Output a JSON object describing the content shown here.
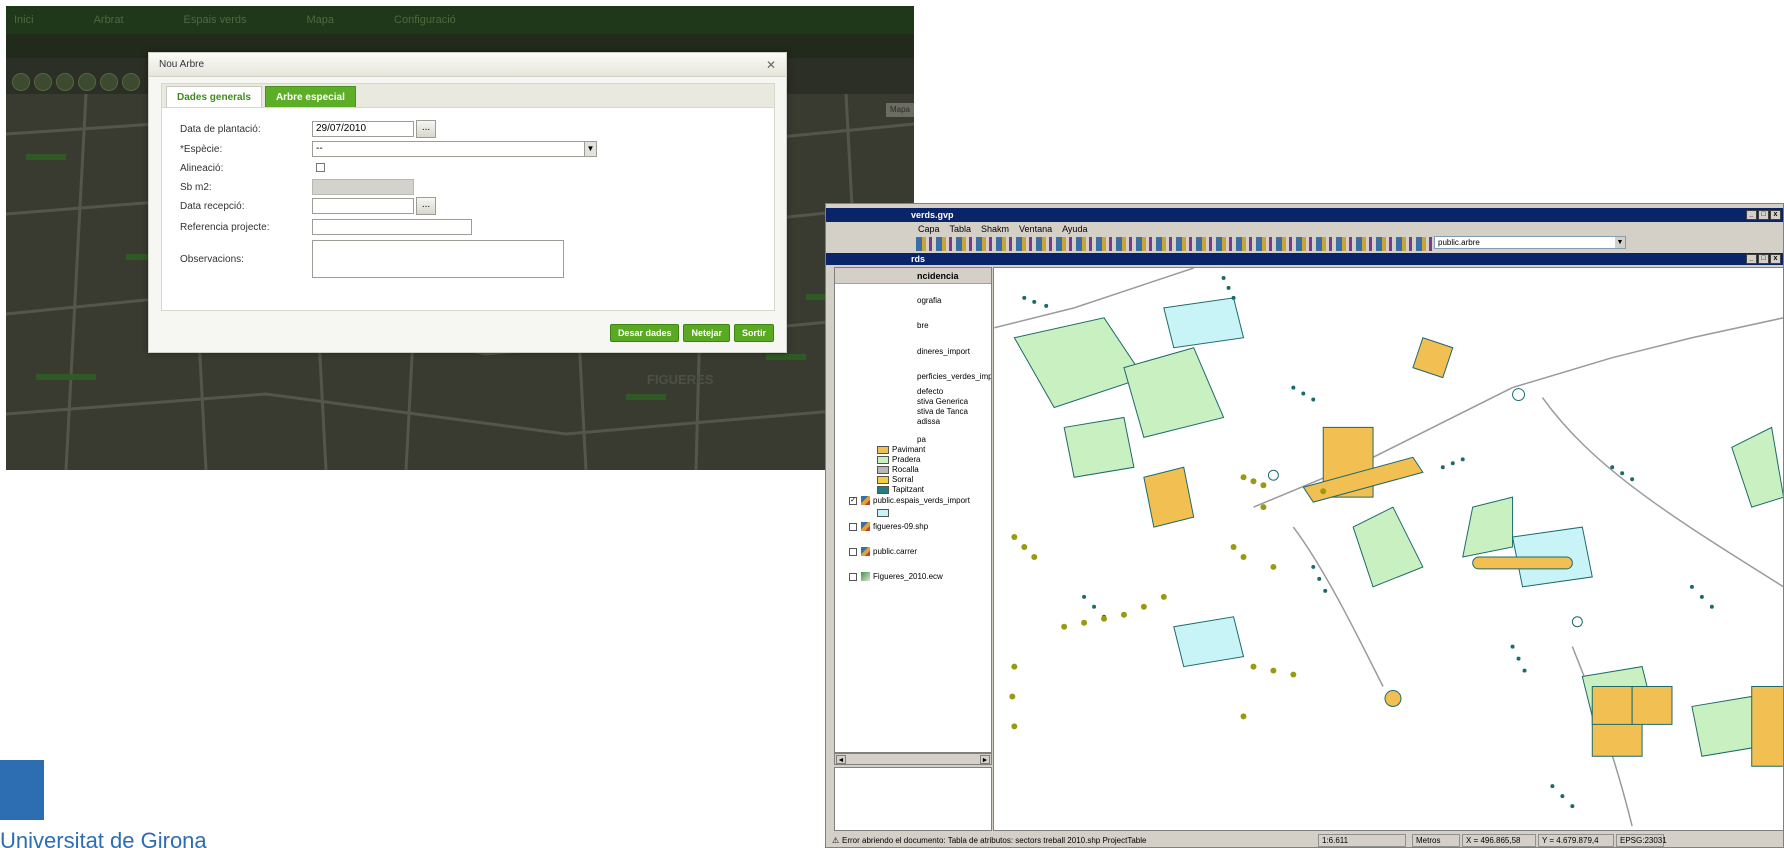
{
  "webapp": {
    "nav_items": [
      "Inici",
      "Arbrat",
      "Espais verds",
      "Mapa",
      "Configuració"
    ],
    "map_button": "Mapa",
    "city_label": "FIGUERES"
  },
  "modal": {
    "title": "Nou Arbre",
    "tabs": [
      {
        "label": "Dades generals",
        "active": false
      },
      {
        "label": "Arbre especial",
        "active": true
      }
    ],
    "fields": {
      "data_plantacio_label": "Data de plantació:",
      "data_plantacio_value": "29/07/2010",
      "especie_label": "*Espècie:",
      "especie_value": "--",
      "alineacio_label": "Alineació:",
      "sbm2_label": "Sb m2:",
      "data_recepcio_label": "Data recepció:",
      "referencia_label": "Referencia projecte:",
      "observacions_label": "Observacions:",
      "dots": "..."
    },
    "buttons": {
      "save": "Desar dades",
      "clear": "Netejar",
      "exit": "Sortir"
    },
    "close_glyph": "✕"
  },
  "gis": {
    "window_title": "verds.gvp",
    "menu": [
      "Capa",
      "Tabla",
      "Shakm",
      "Ventana",
      "Ayuda"
    ],
    "layer_select": "public.arbre",
    "doc_title": "rds",
    "toc_header": "ncidencia",
    "toc_items": [
      {
        "label": "ografia"
      },
      {
        "label": "bre"
      },
      {
        "label": "dineres_import"
      },
      {
        "label": "perficies_verdes_import"
      },
      {
        "label": "defecto"
      },
      {
        "label": "stiva Generica"
      },
      {
        "label": "stiva de Tanca"
      },
      {
        "label": "adissa"
      },
      {
        "label": "pa"
      }
    ],
    "legend": [
      {
        "label": "Pavimant",
        "color": "#f2c052"
      },
      {
        "label": "Pradera",
        "color": "#c8f0c0"
      },
      {
        "label": "Rocalla",
        "color": "#b8b8b8"
      },
      {
        "label": "Sorral",
        "color": "#f0d040"
      },
      {
        "label": "Tapitzant",
        "color": "#208080"
      }
    ],
    "layers": [
      {
        "label": "public.espais_verds_import",
        "checked": true
      },
      {
        "label": "figueres-09.shp",
        "checked": false
      },
      {
        "label": "public.carrer",
        "checked": false
      },
      {
        "label": "Figueres_2010.ecw",
        "checked": false
      }
    ],
    "status": {
      "message": "Error abriendo el documento: Tabla de atributos: sectors treball 2010.shp  ProjectTable",
      "scale": "1:6.611",
      "units": "Metros",
      "x": "X = 496.865,58",
      "y": "Y = 4.679.879,4",
      "epsg": "EPSG:23031"
    },
    "colors": {
      "tree": "#1c6a6a",
      "green_area": "#c8f0c0",
      "water": "#c8f4f8",
      "pavement": "#f2c052",
      "olive_trees": "#9a9a10"
    }
  },
  "logo": {
    "name": "Universitat de Girona"
  }
}
